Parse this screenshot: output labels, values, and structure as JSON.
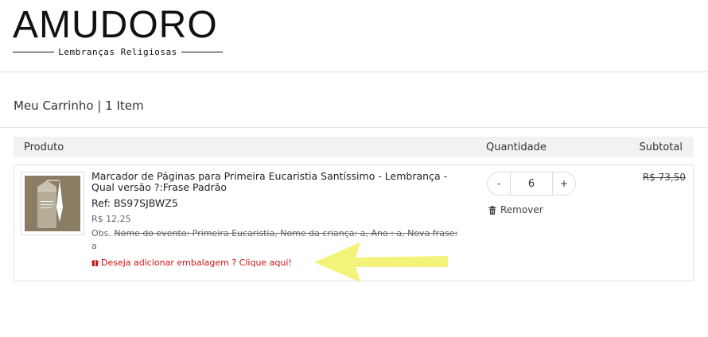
{
  "brand": {
    "name": "AMUDORO",
    "tagline": "Lembranças Religiosas"
  },
  "cart": {
    "title": "Meu Carrinho | 1 Item"
  },
  "table": {
    "headers": {
      "product": "Produto",
      "quantity": "Quantidade",
      "subtotal": "Subtotal"
    }
  },
  "item": {
    "name": "Marcador de Páginas para Primeira Eucaristia Santíssimo - Lembrança - Qual versão ?:Frase Padrão",
    "ref": "Ref: BS97SJBWZ5",
    "price": "R$ 12,25",
    "obs_label": "Obs.",
    "obs_text": "Nome do evento: Primeira Eucaristia, Nome da criança: a, Ano : a, Nova frase:",
    "obs_tail": "a",
    "gift_link": "Deseja adicionar embalagem ? Clique aqui!",
    "quantity": {
      "minus": "-",
      "value": "6",
      "plus": "+"
    },
    "remove_label": "Remover",
    "subtotal": "R$ 73,50"
  },
  "colors": {
    "link_red": "#cc1111",
    "arrow_yellow": "#f3f37a",
    "header_bg": "#f2f2f2"
  },
  "icons": {
    "gift": "gift-icon",
    "trash": "trash-icon",
    "arrow": "arrow-left-icon"
  }
}
